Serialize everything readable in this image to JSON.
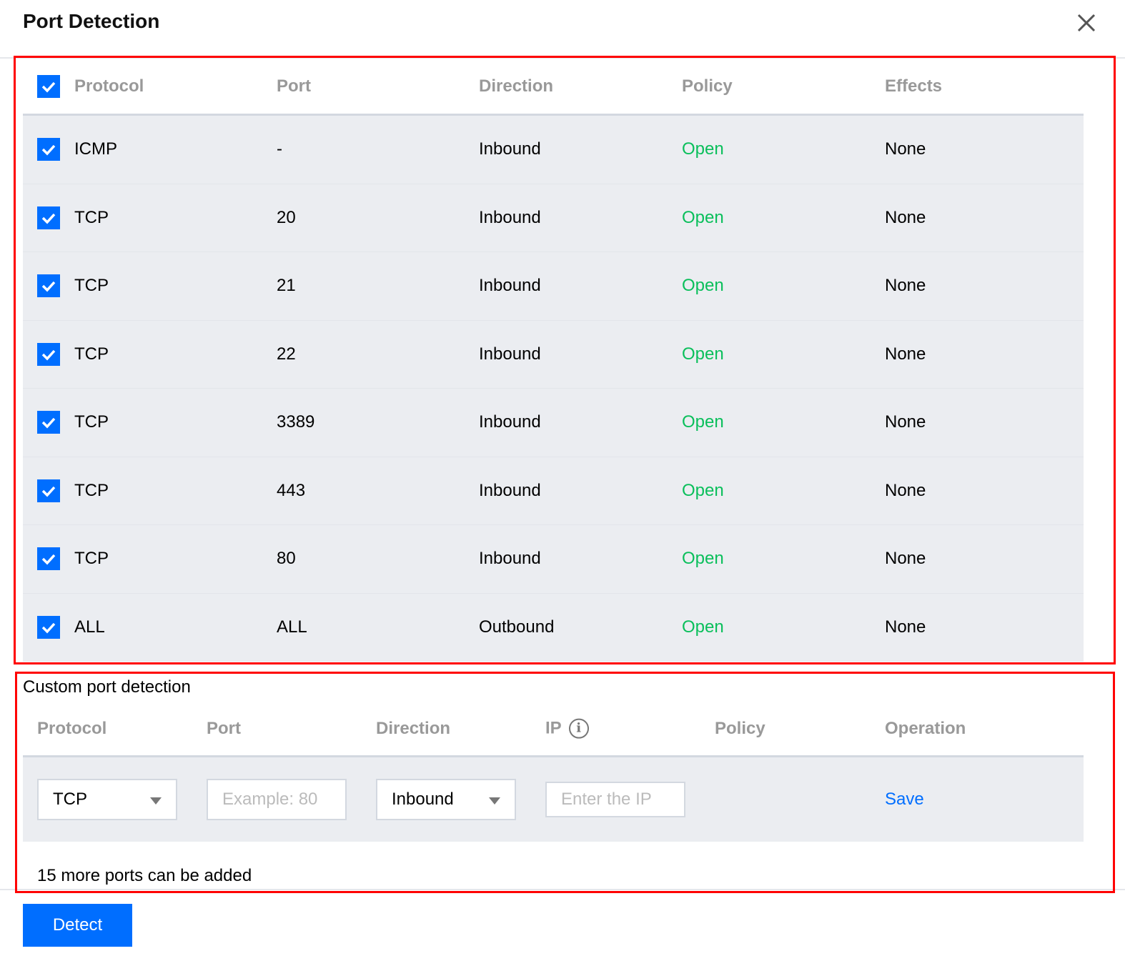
{
  "dialog": {
    "title": "Port Detection",
    "close_icon": "close-icon"
  },
  "table": {
    "headers": [
      "Protocol",
      "Port",
      "Direction",
      "Policy",
      "Effects"
    ],
    "rows": [
      {
        "protocol": "ICMP",
        "port": "-",
        "direction": "Inbound",
        "policy": "Open",
        "effects": "None"
      },
      {
        "protocol": "TCP",
        "port": "20",
        "direction": "Inbound",
        "policy": "Open",
        "effects": "None"
      },
      {
        "protocol": "TCP",
        "port": "21",
        "direction": "Inbound",
        "policy": "Open",
        "effects": "None"
      },
      {
        "protocol": "TCP",
        "port": "22",
        "direction": "Inbound",
        "policy": "Open",
        "effects": "None"
      },
      {
        "protocol": "TCP",
        "port": "3389",
        "direction": "Inbound",
        "policy": "Open",
        "effects": "None"
      },
      {
        "protocol": "TCP",
        "port": "443",
        "direction": "Inbound",
        "policy": "Open",
        "effects": "None"
      },
      {
        "protocol": "TCP",
        "port": "80",
        "direction": "Inbound",
        "policy": "Open",
        "effects": "None"
      },
      {
        "protocol": "ALL",
        "port": "ALL",
        "direction": "Outbound",
        "policy": "Open",
        "effects": "None"
      }
    ]
  },
  "custom": {
    "title": "Custom port detection",
    "headers": [
      "Protocol",
      "Port",
      "Direction",
      "IP",
      "Policy",
      "Operation"
    ],
    "protocol_value": "TCP",
    "port_placeholder": "Example: 80",
    "direction_value": "Inbound",
    "ip_placeholder": "Enter the IP",
    "save_label": "Save",
    "info_icon": "i",
    "remaining": "15 more ports can be added"
  },
  "detect_label": "Detect",
  "colors": {
    "accent": "#006eff",
    "open": "#0abf5b",
    "highlight": "#ff0000"
  }
}
